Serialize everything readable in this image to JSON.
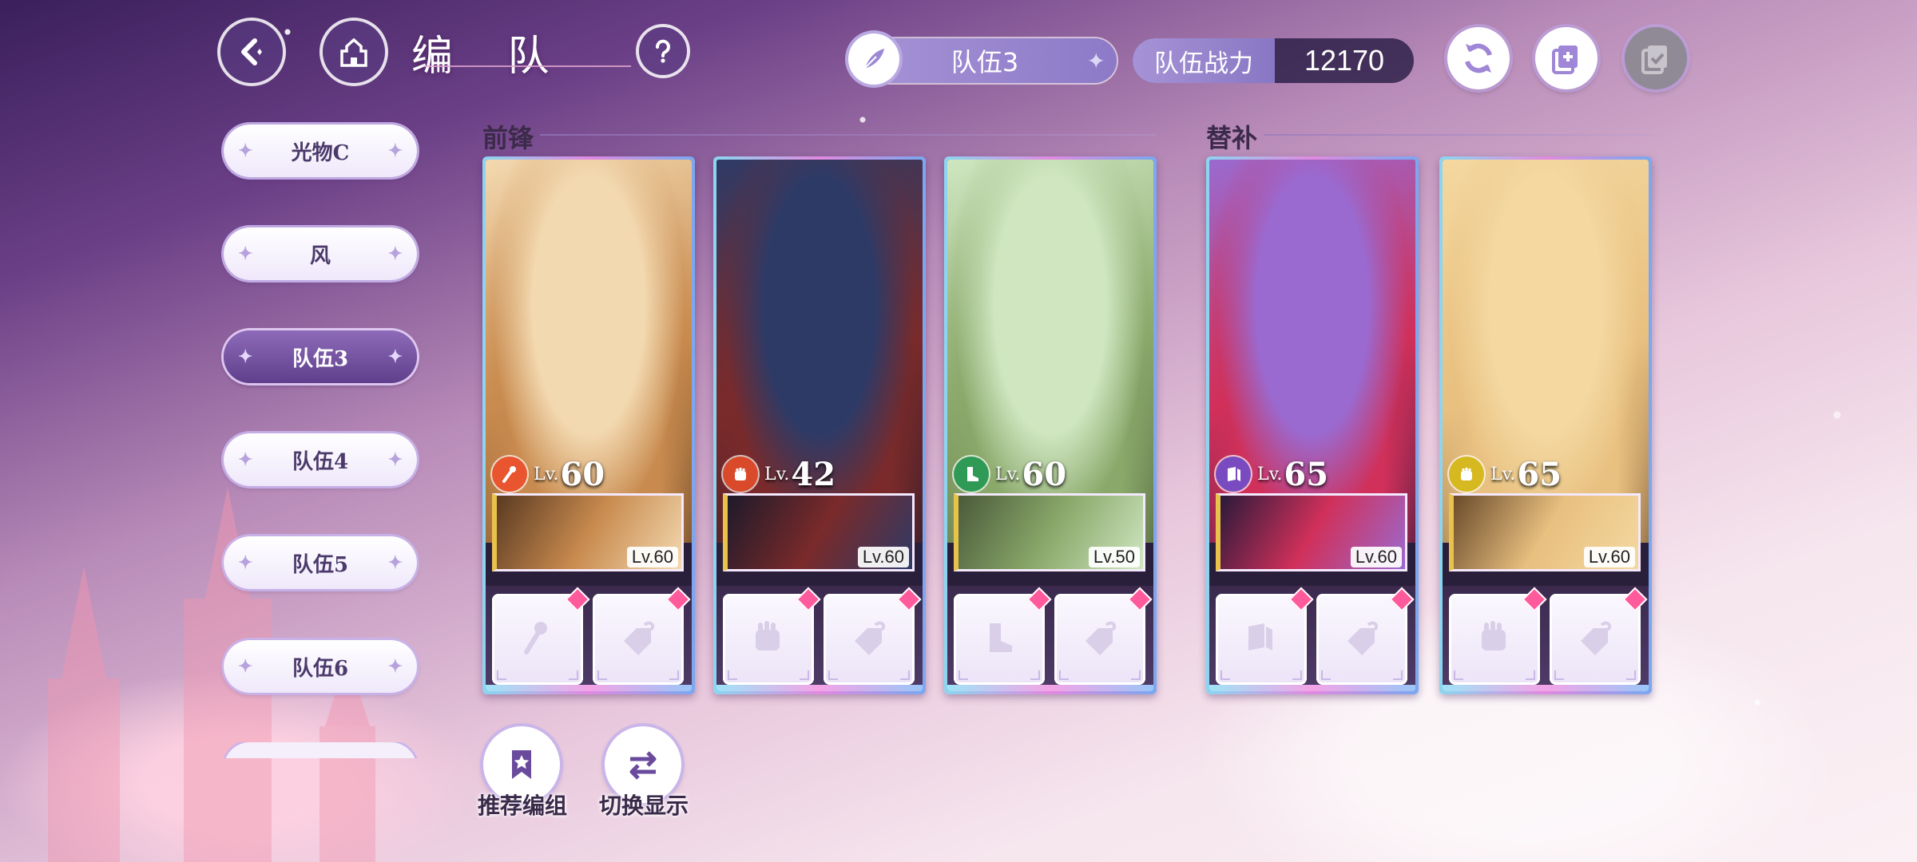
{
  "header": {
    "title": "编 队",
    "title_script": "formation",
    "team_name": "队伍3",
    "power_label": "队伍战力",
    "power_value": "12170"
  },
  "icons": {
    "back": "back-arrow-icon",
    "home": "castle-home-icon",
    "help": "question-mark-icon",
    "rename": "feather-icon",
    "refresh": "refresh-icon",
    "copy": "copy-add-icon",
    "confirm": "confirm-check-icon"
  },
  "sidebar": {
    "teams": [
      {
        "label": "光物C",
        "active": false
      },
      {
        "label": "风",
        "active": false
      },
      {
        "label": "队伍3",
        "active": true
      },
      {
        "label": "队伍4",
        "active": false
      },
      {
        "label": "队伍5",
        "active": false
      },
      {
        "label": "队伍6",
        "active": false
      }
    ]
  },
  "sections": {
    "front": "前锋",
    "bench": "替补"
  },
  "cards": [
    {
      "char_level_prefix": "Lv.",
      "char_level": "60",
      "class_color": "#e8552e",
      "class_icon": "wand-icon",
      "support_level": "Lv.60",
      "slots": [
        "wand-slot-icon",
        "hook-slot-icon"
      ],
      "palette": [
        "#f3d9b0",
        "#c88a4e",
        "#5a3a22"
      ]
    },
    {
      "char_level_prefix": "Lv.",
      "char_level": "42",
      "class_color": "#d94a2a",
      "class_icon": "fist-icon",
      "support_level": "Lv.60",
      "slots": [
        "fist-slot-icon",
        "hook-slot-icon"
      ],
      "palette": [
        "#2e3a66",
        "#7a2a2a",
        "#1d1a2a"
      ]
    },
    {
      "char_level_prefix": "Lv.",
      "char_level": "60",
      "class_color": "#2f9a55",
      "class_icon": "boot-icon",
      "support_level": "Lv.50",
      "slots": [
        "boot-slot-icon",
        "hook-slot-icon"
      ],
      "palette": [
        "#cfe6c0",
        "#8aa86a",
        "#4a5a3a"
      ]
    },
    {
      "char_level_prefix": "Lv.",
      "char_level": "65",
      "class_color": "#7a4bc0",
      "class_icon": "book-icon",
      "support_level": "Lv.60",
      "slots": [
        "book-slot-icon",
        "hook-slot-icon"
      ],
      "palette": [
        "#9a6ad0",
        "#d0305a",
        "#2a1a3a"
      ]
    },
    {
      "char_level_prefix": "Lv.",
      "char_level": "65",
      "class_color": "#d6b820",
      "class_icon": "fist-icon",
      "support_level": "Lv.60",
      "slots": [
        "fist-slot-icon",
        "hook-slot-icon"
      ],
      "palette": [
        "#f4d8a0",
        "#e8c080",
        "#6a4a2a"
      ]
    }
  ],
  "bottom_buttons": {
    "recommend": "推荐编组",
    "switch_view": "切换显示"
  }
}
